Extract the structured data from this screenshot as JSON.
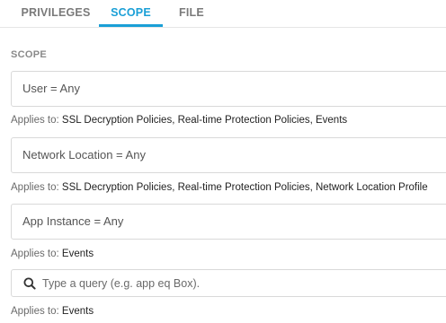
{
  "tabs": [
    {
      "label": "PRIVILEGES",
      "active": false
    },
    {
      "label": "SCOPE",
      "active": true
    },
    {
      "label": "FILE",
      "active": false
    }
  ],
  "scope": {
    "section_label": "SCOPE",
    "applies_label": "Applies to:",
    "fields": [
      {
        "value": "User = Any",
        "applies_to": "SSL Decryption Policies, Real-time Protection Policies, Events"
      },
      {
        "value": "Network Location = Any",
        "applies_to": "SSL Decryption Policies, Real-time Protection Policies, Network Location Profile"
      },
      {
        "value": "App Instance = Any",
        "applies_to": "Events"
      }
    ],
    "query": {
      "placeholder": "Type a query (e.g. app eq Box).",
      "value": "",
      "applies_to": "Events"
    }
  },
  "colors": {
    "accent": "#1a9fd6",
    "border": "#d9d9d9",
    "muted_text": "#7a7a7a"
  },
  "icons": {
    "query": "search-icon"
  }
}
